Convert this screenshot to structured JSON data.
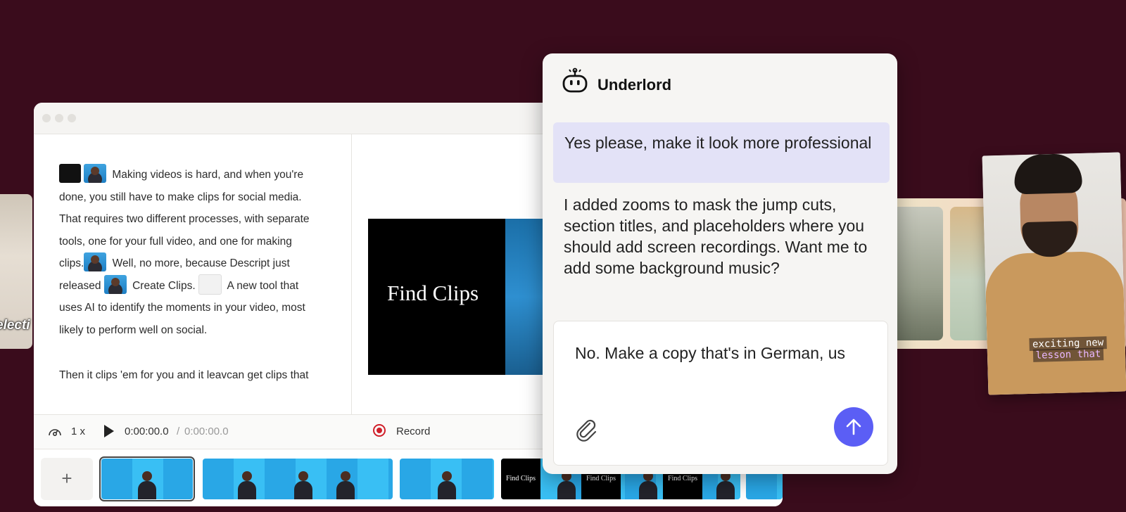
{
  "background": {
    "left_card_caption": "electi",
    "portrait_caption_line1": "exciting new",
    "portrait_caption_line2": "lesson that"
  },
  "editor": {
    "script": {
      "line1": "Making videos is hard, and when you're",
      "line2": "done, you still have to make clips for social media.",
      "line3": "That requires two different processes, with separate",
      "line4": "tools, one for your full video, and one for making",
      "line5a": "clips.",
      "line5b": "Well, no more, because Descript just",
      "line6a": "released",
      "line6b": "Create Clips.",
      "line6c": "A new tool that",
      "line7": "uses AI to identify the moments in your video, most",
      "line8": "likely to perform well on social.",
      "paragraph2": "Then it clips 'em for you and it leavcan get clips that"
    },
    "preview": {
      "title_card": "Find Clips"
    },
    "transport": {
      "speed": "1 x",
      "time_current": "0:00:00.0",
      "time_separator": "/",
      "time_total": "0:00:00.0",
      "record_label": "Record"
    },
    "timeline": {
      "add_label": "+",
      "find_clips_frame": "Find Clips"
    }
  },
  "chat": {
    "title": "Underlord",
    "user_message": "Yes please, make it look more professional",
    "assistant_message": "I added zooms to mask the jump cuts, section titles, and placeholders where you should add screen recordings. Want me to add some background music?",
    "input_value": "No. Make a copy that's in German, us",
    "accent_color": "#5b5ef5"
  },
  "icons": [
    "robot-icon",
    "paperclip-icon",
    "arrow-up-icon",
    "play-icon",
    "record-icon",
    "speed-icon",
    "plus-icon"
  ]
}
